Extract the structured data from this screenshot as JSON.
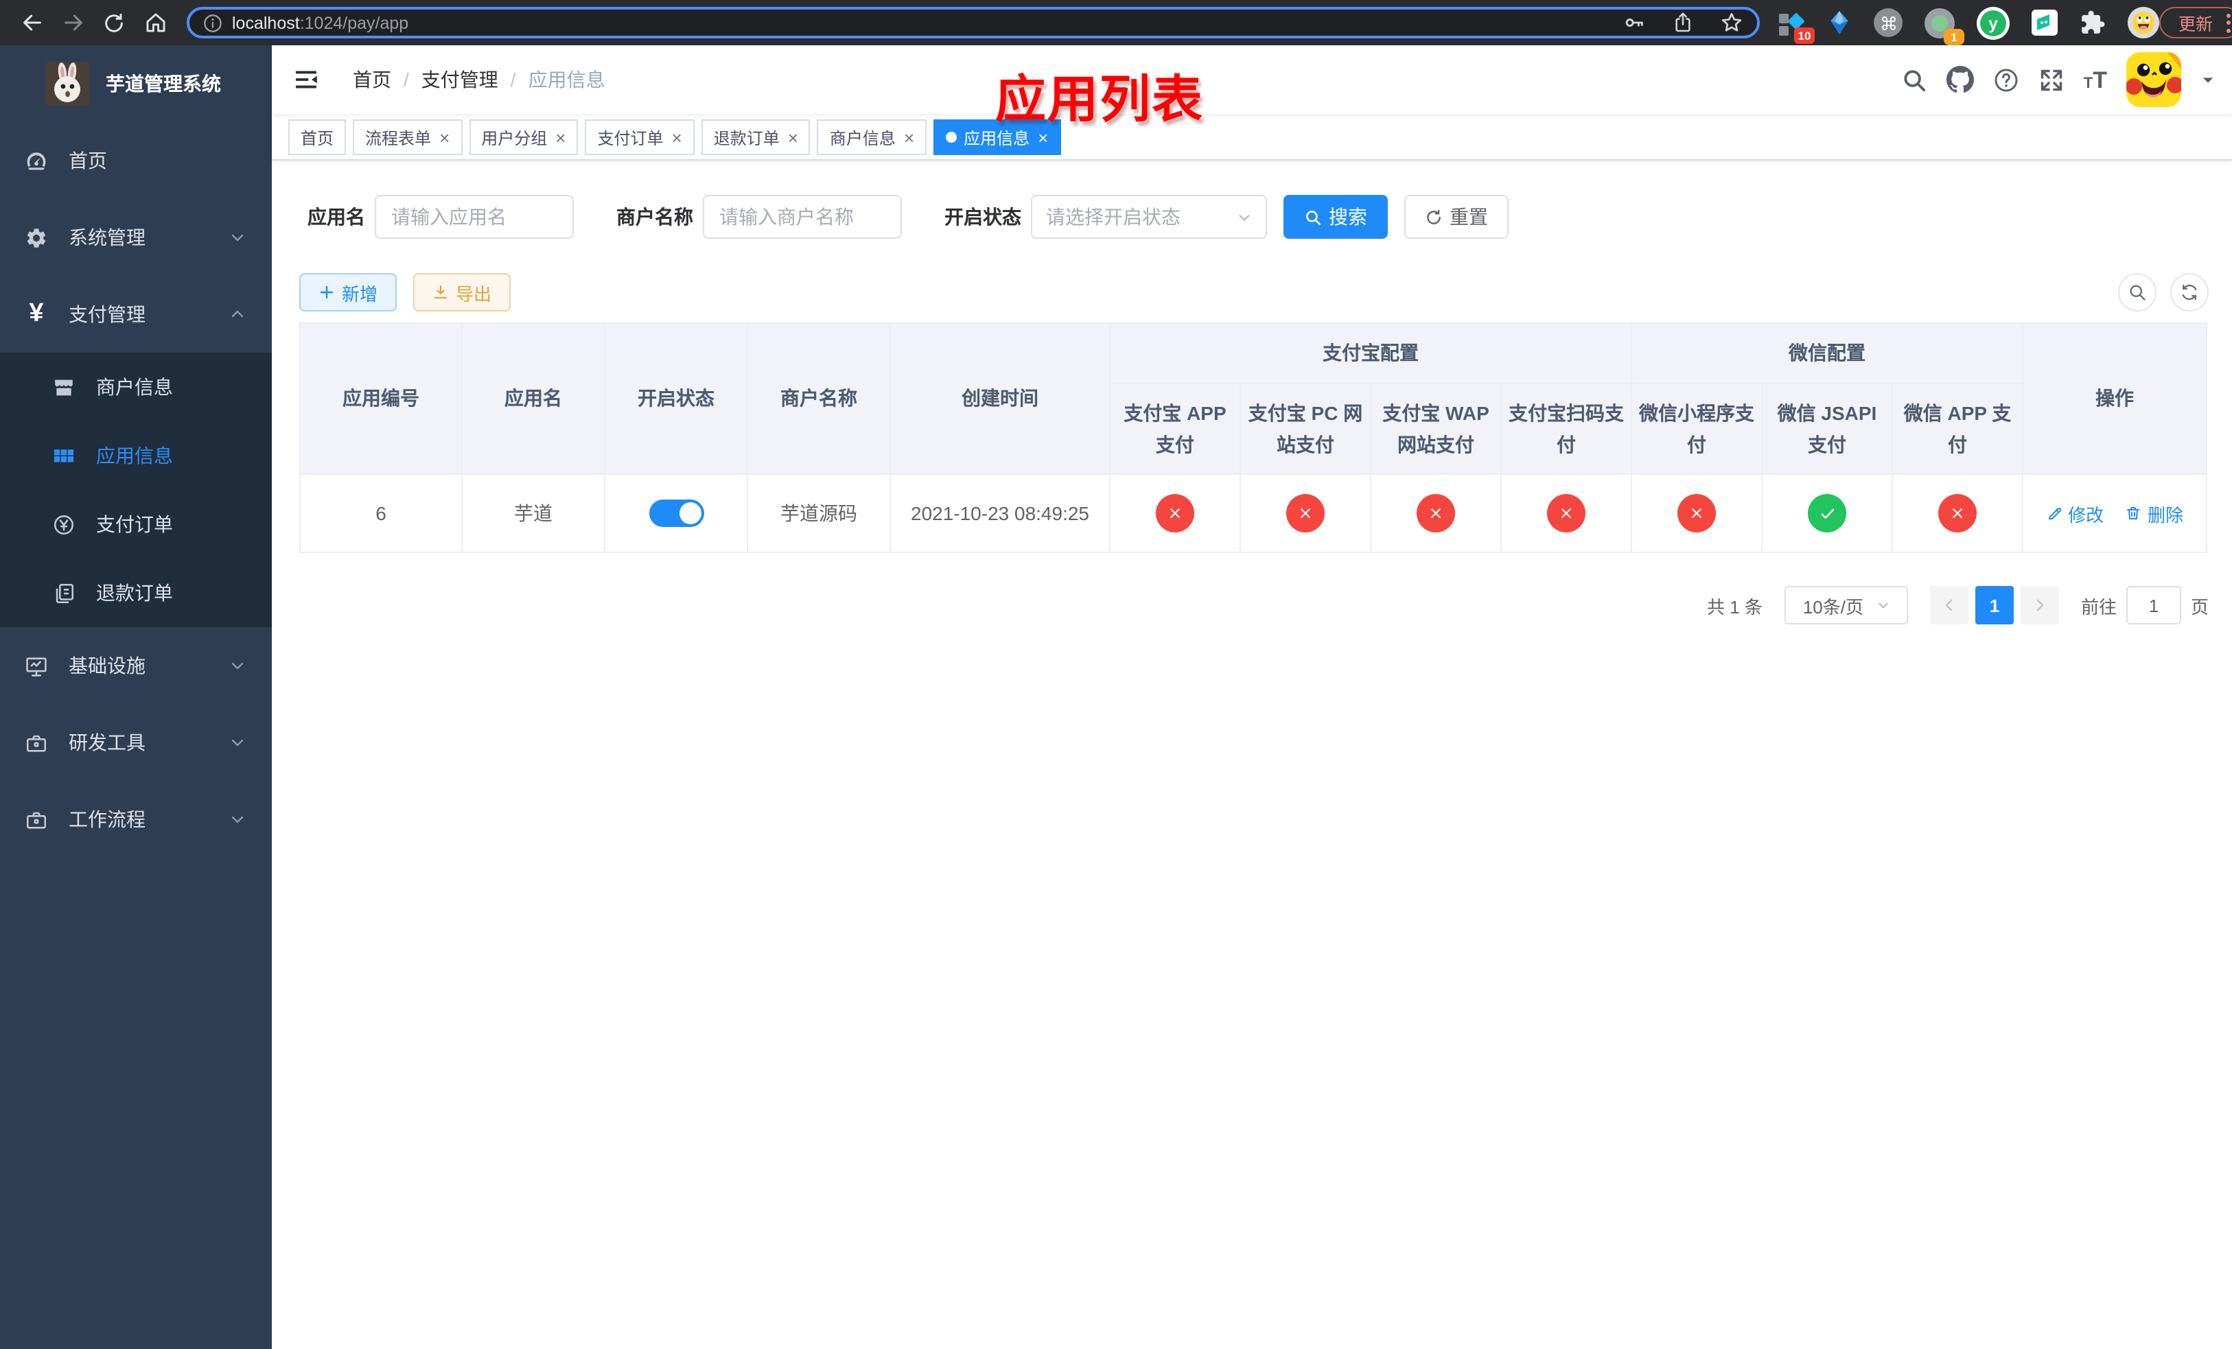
{
  "browser": {
    "url_host": "localhost",
    "url_rest": ":1024/pay/app",
    "update_label": "更新",
    "ext_badge_blue": "10",
    "ext_badge_green": "1"
  },
  "sidebar": {
    "title": "芋道管理系统",
    "items": [
      {
        "label": "首页"
      },
      {
        "label": "系统管理"
      },
      {
        "label": "支付管理"
      },
      {
        "label": "商户信息"
      },
      {
        "label": "应用信息"
      },
      {
        "label": "支付订单"
      },
      {
        "label": "退款订单"
      },
      {
        "label": "基础设施"
      },
      {
        "label": "研发工具"
      },
      {
        "label": "工作流程"
      }
    ]
  },
  "navbar": {
    "breadcrumb": [
      "首页",
      "支付管理",
      "应用信息"
    ],
    "annotation": "应用列表"
  },
  "tabs": [
    {
      "label": "首页"
    },
    {
      "label": "流程表单"
    },
    {
      "label": "用户分组"
    },
    {
      "label": "支付订单"
    },
    {
      "label": "退款订单"
    },
    {
      "label": "商户信息"
    },
    {
      "label": "应用信息"
    }
  ],
  "filters": {
    "app_name_label": "应用名",
    "app_name_placeholder": "请输入应用名",
    "merchant_label": "商户名称",
    "merchant_placeholder": "请输入商户名称",
    "status_label": "开启状态",
    "status_placeholder": "请选择开启状态",
    "search_label": "搜索",
    "reset_label": "重置"
  },
  "toolbar": {
    "add_label": "新增",
    "export_label": "导出"
  },
  "table": {
    "columns": [
      "应用编号",
      "应用名",
      "开启状态",
      "商户名称",
      "创建时间"
    ],
    "groups": [
      {
        "label": "支付宝配置",
        "children": [
          "支付宝 APP 支付",
          "支付宝 PC 网站支付",
          "支付宝 WAP 网站支付",
          "支付宝扫码支付"
        ]
      },
      {
        "label": "微信配置",
        "children": [
          "微信小程序支付",
          "微信 JSAPI 支付",
          "微信 APP 支付"
        ]
      }
    ],
    "ops_label": "操作",
    "row": {
      "id": "6",
      "name": "芋道",
      "enabled": true,
      "merchant": "芋道源码",
      "created": "2021-10-23 08:49:25",
      "statuses": [
        "no",
        "no",
        "no",
        "no",
        "no",
        "yes",
        "no"
      ],
      "edit_label": "修改",
      "delete_label": "删除"
    }
  },
  "pagination": {
    "total": "共 1 条",
    "page_size": "10条/页",
    "page": "1",
    "goto_label": "前往",
    "goto_value": "1",
    "page_unit": "页"
  }
}
